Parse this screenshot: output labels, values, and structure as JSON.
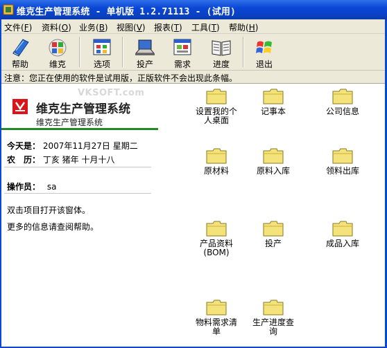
{
  "window": {
    "title": "维克生产管理系统 - 单机版 1.2.71113 - (试用)"
  },
  "menu": [
    {
      "label": "文件(",
      "key": "F",
      "end": ")"
    },
    {
      "label": "资料(",
      "key": "O",
      "end": ")"
    },
    {
      "label": "业务(",
      "key": "B",
      "end": ")"
    },
    {
      "label": "视图(",
      "key": "V",
      "end": ")"
    },
    {
      "label": "报表(",
      "key": "T",
      "end": ")"
    },
    {
      "label": "工具(",
      "key": "T",
      "end": ")"
    },
    {
      "label": "帮助(",
      "key": "H",
      "end": ")"
    }
  ],
  "toolbar": {
    "help": "帮助",
    "vk": "维克",
    "options": "选项",
    "production": "投产",
    "demand": "需求",
    "progress": "进度",
    "exit": "退出"
  },
  "notice": "注意：您正在使用的软件是试用版，正版软件不会出现此条幅。",
  "info": {
    "watermark": "VKSOFT.com",
    "brand_title": "维克生产管理系统",
    "brand_subtitle": "维克生产管理系统",
    "today_label": "今天是：",
    "today_value": "2007年11月27日 星期二",
    "lunar_label": "农　历：",
    "lunar_value": "丁亥 猪年 十月十八",
    "operator_label": "操作员：",
    "operator_value": "sa",
    "hint1": "双击项目打开该窗体。",
    "hint2": "更多的信息请查阅帮助。"
  },
  "folders": [
    {
      "l1": "设置我的个",
      "l2": "人桌面"
    },
    {
      "l1": "记事本",
      "l2": ""
    },
    {
      "l1": "公司信息",
      "l2": ""
    },
    {
      "l1": "原材料",
      "l2": ""
    },
    {
      "l1": "原料入库",
      "l2": ""
    },
    {
      "l1": "领料出库",
      "l2": ""
    },
    {
      "l1": "产品资料",
      "l2": "(BOM)"
    },
    {
      "l1": "投产",
      "l2": ""
    },
    {
      "l1": "成品入库",
      "l2": ""
    },
    {
      "l1": "物料需求清",
      "l2": "单"
    },
    {
      "l1": "生产进度查",
      "l2": "询"
    }
  ],
  "colors": {
    "title_bar": "#0a47d6",
    "chrome": "#ece9d8",
    "folder": "#f4e27a",
    "brand_line": "#1e8a2a",
    "logo_red": "#d8161b"
  }
}
